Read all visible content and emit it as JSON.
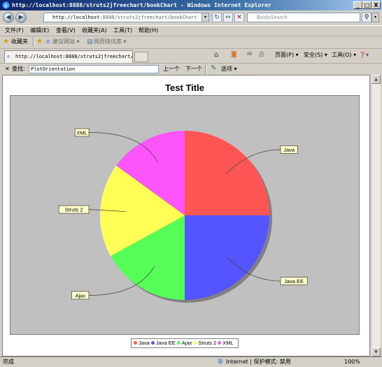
{
  "window": {
    "title": "http://localhost:8888/struts2jfreechart/bookChart - Windows Internet Explorer",
    "minimize_glyph": "_",
    "maximize_glyph": "□",
    "close_glyph": "X"
  },
  "address_bar": {
    "host": "http://localhost",
    "path": ":8888/struts2jfreechart/bookChart",
    "search_placeholder": "BaiduSearch",
    "refresh_glyph": "↻",
    "go_glyph": "↔",
    "stop_glyph": "✕",
    "search_glyph": "⚲",
    "dropdown_glyph": "▾"
  },
  "menu": {
    "items": [
      "文件(F)",
      "编辑(E)",
      "查看(V)",
      "收藏夹(A)",
      "工具(T)",
      "帮助(H)"
    ]
  },
  "favorites_bar": {
    "favorites_label": "收藏夹",
    "suggested_sites": "建议网站 ▾",
    "web_slice": "网页快讯库 ▾"
  },
  "tabs": {
    "active_tab_title": "http://localhost:8888/struts2jfreechart/b..."
  },
  "command_bar": {
    "page": "页面(P) ▾",
    "safety": "安全(S) ▾",
    "tools": "工具(O) ▾",
    "help": "❓▾"
  },
  "find_bar": {
    "close_glyph": "✕",
    "label": "查找:",
    "query": "PlotOrientation",
    "previous": "上一个",
    "next": "下一个",
    "options": "选项 ▾"
  },
  "chart_data": {
    "type": "pie",
    "title": "Test Title",
    "slices": [
      {
        "label": "Java",
        "value": 25,
        "color": "#ff5555"
      },
      {
        "label": "Java EE",
        "value": 25,
        "color": "#5555ff"
      },
      {
        "label": "Ajax",
        "value": 17,
        "color": "#55ff55"
      },
      {
        "label": "Struts 2",
        "value": 18,
        "color": "#ffff55"
      },
      {
        "label": "XML",
        "value": 15,
        "color": "#ff55ff"
      }
    ],
    "start_angle": 90,
    "direction": "clockwise",
    "plot_background": "#c0c0c0",
    "legend_position": "bottom"
  },
  "status_bar": {
    "status": "完成",
    "zone": "Internet | 保护模式: 禁用",
    "zoom": "100%"
  },
  "colors": {
    "titlebar_start": "#0a246a",
    "chrome": "#d4d0c8",
    "label_box_fill": "#ffffcc"
  }
}
